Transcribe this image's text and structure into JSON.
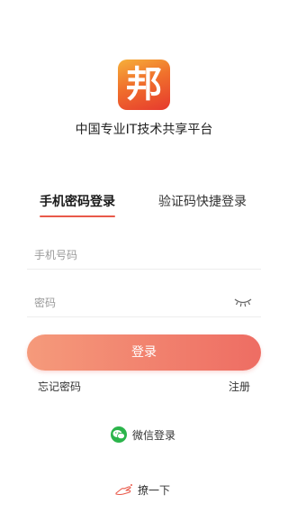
{
  "colors": {
    "accent": "#e9594a",
    "button_start": "#f59a7b",
    "button_end": "#ee6d63",
    "wechat_green": "#2bb44b",
    "logo_top": "#f6b03a",
    "logo_bottom": "#e6392e"
  },
  "logo": {
    "glyph": "邦"
  },
  "slogan": "中国专业IT技术共享平台",
  "tabs": [
    {
      "label": "手机密码登录",
      "active": true
    },
    {
      "label": "验证码快捷登录",
      "active": false
    }
  ],
  "form": {
    "phone_placeholder": "手机号码",
    "password_placeholder": "密码",
    "password_toggle_icon": "eye-closed-icon"
  },
  "login_button": "登录",
  "links": {
    "forgot_password": "忘记密码",
    "register": "注册"
  },
  "wechat": {
    "label": "微信登录",
    "icon": "wechat-icon"
  },
  "visit": {
    "label": "撩一下",
    "icon": "hand-icon"
  }
}
